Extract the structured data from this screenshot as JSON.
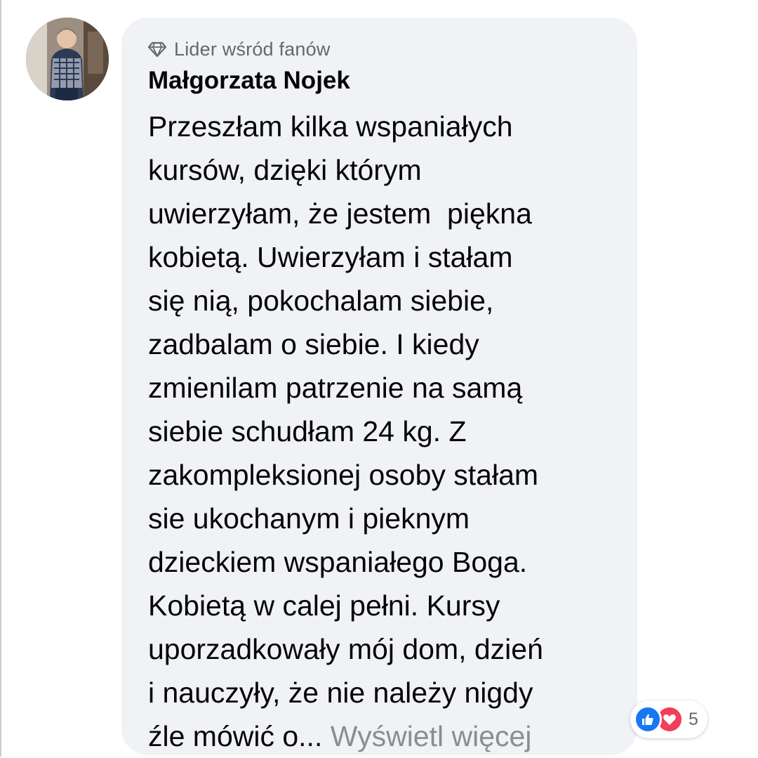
{
  "comment": {
    "badge": {
      "icon": "diamond-icon",
      "label": "Lider wśród fanów"
    },
    "author": "Małgorzata Nojek",
    "text_lines": [
      "Przeszłam kilka wspaniałych",
      "kursów, dzięki którym",
      "uwierzyłam, że jestem  piękna",
      "kobietą. Uwierzyłam i stałam",
      "się nią, pokochalam siebie,",
      "zadbalam o siebie. I kiedy",
      "zmienilam patrzenie na samą",
      "siebie schudłam 24 kg. Z",
      "zakompleksionej osoby stałam",
      "sie ukochanym i pieknym",
      "dzieckiem wspaniałego Boga.",
      "Kobietą w calej pełni. Kursy",
      "uporzadkowały mój dom, dzień",
      "i nauczyły, że nie należy nigdy"
    ],
    "last_line": "źle mówić o...",
    "see_more": "Wyświetl więcej",
    "reactions": {
      "icons": [
        "like-icon",
        "love-icon"
      ],
      "count": "5"
    }
  },
  "colors": {
    "bubble_bg": "#f0f2f5",
    "text": "#050505",
    "secondary_text": "#65676b",
    "like_blue": "#1877f2",
    "love_red": "#f33e58"
  }
}
